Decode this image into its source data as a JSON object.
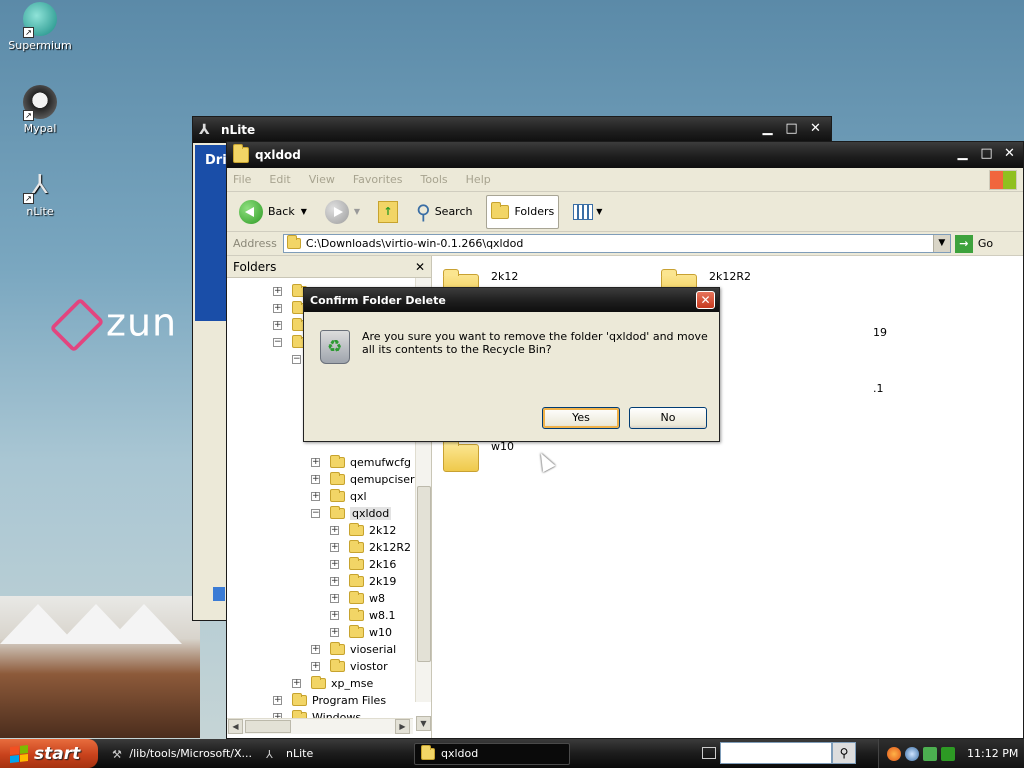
{
  "desktop": {
    "icons": [
      {
        "label": "Supermium"
      },
      {
        "label": "Mypal"
      },
      {
        "label": "nLite"
      }
    ],
    "wallpaper_brand": "zun"
  },
  "nlite": {
    "title": "nLite",
    "panel_text": "Driv"
  },
  "explorer": {
    "title": "qxldod",
    "menu": [
      "File",
      "Edit",
      "View",
      "Favorites",
      "Tools",
      "Help"
    ],
    "toolbar": {
      "back": "Back",
      "search": "Search",
      "folders": "Folders"
    },
    "address": {
      "label": "Address",
      "value": "C:\\Downloads\\virtio-win-0.1.266\\qxldod",
      "go": "Go"
    },
    "folders_pane": {
      "header": "Folders",
      "tree": [
        {
          "label": "qemufwcfg"
        },
        {
          "label": "qemupciserial"
        },
        {
          "label": "qxl"
        },
        {
          "label": "qxldod"
        },
        {
          "label": "2k12"
        },
        {
          "label": "2k12R2"
        },
        {
          "label": "2k16"
        },
        {
          "label": "2k19"
        },
        {
          "label": "w8"
        },
        {
          "label": "w8.1"
        },
        {
          "label": "w10"
        },
        {
          "label": "vioserial"
        },
        {
          "label": "viostor"
        },
        {
          "label": "xp_mse"
        },
        {
          "label": "Program Files"
        },
        {
          "label": "Windows"
        }
      ]
    },
    "files": [
      {
        "label": "2k12"
      },
      {
        "label": "2k12R2"
      },
      {
        "label": "19"
      },
      {
        "label": ".1"
      },
      {
        "label": "w10"
      }
    ]
  },
  "dialog": {
    "title": "Confirm Folder Delete",
    "message": "Are you sure you want to remove the folder 'qxldod' and move all its contents to the Recycle Bin?",
    "yes": "Yes",
    "no": "No"
  },
  "taskbar": {
    "start": "start",
    "tasks": [
      {
        "label": "/lib/tools/Microsoft/X..."
      },
      {
        "label": "nLite"
      },
      {
        "label": "qxldod"
      }
    ],
    "clock": "11:12 PM"
  },
  "colors": {
    "titlebar": "#1e1e1e",
    "start_button": "#c8421c",
    "dialog_close": "#c6391f",
    "folder_yellow": "#f2d566"
  }
}
